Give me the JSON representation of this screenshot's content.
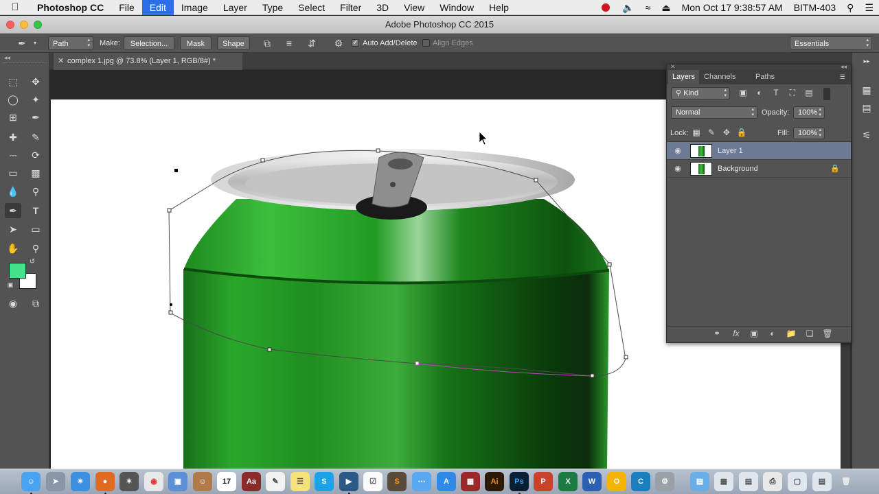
{
  "menubar": {
    "app_name": "Photoshop CC",
    "items": [
      "File",
      "Edit",
      "Image",
      "Layer",
      "Type",
      "Select",
      "Filter",
      "3D",
      "View",
      "Window",
      "Help"
    ],
    "active_item": "Edit",
    "datetime": "Mon Oct 17  9:38:57 AM",
    "user": "BITM-403"
  },
  "window": {
    "title": "Adobe Photoshop CC 2015"
  },
  "options_bar": {
    "tool_mode": "Path",
    "make_label": "Make:",
    "selection_button": "Selection...",
    "mask_button": "Mask",
    "shape_button": "Shape",
    "auto_add_delete_label": "Auto Add/Delete",
    "auto_add_delete_checked": true,
    "align_edges_label": "Align Edges",
    "align_edges_checked": false,
    "workspace": "Essentials"
  },
  "document": {
    "tab_title": "complex 1.jpg @ 73.8% (Layer 1, RGB/8#) *"
  },
  "colors": {
    "foreground": "#44e38b",
    "background": "#ffffff",
    "can_green": "#1f8a1f",
    "selected_layer": "#6c7b93"
  },
  "layers_panel": {
    "tabs": [
      "Layers",
      "Channels",
      "Paths"
    ],
    "active_tab": "Layers",
    "filter_kind": "Kind",
    "blend_mode": "Normal",
    "opacity_label": "Opacity:",
    "opacity_value": "100%",
    "lock_label": "Lock:",
    "fill_label": "Fill:",
    "fill_value": "100%",
    "layers": [
      {
        "name": "Layer 1",
        "selected": true,
        "locked": false
      },
      {
        "name": "Background",
        "selected": false,
        "locked": true
      }
    ]
  },
  "dock": {
    "apps": [
      "finder-icon",
      "launchpad-icon",
      "safari-icon",
      "firefox-icon",
      "compass-icon",
      "chrome-icon",
      "preview-icon",
      "contacts-icon",
      "calendar-icon",
      "dictionary-icon",
      "textedit-icon",
      "notes-icon",
      "skype-icon",
      "quicktime-icon",
      "reminders-icon",
      "sublime-icon",
      "messages-icon",
      "appstore-icon",
      "photobooth-icon",
      "illustrator-icon",
      "photoshop-icon",
      "powerpoint-icon",
      "excel-icon",
      "word-icon",
      "vlc-icon",
      "cyberduck-icon",
      "system-preferences-icon",
      "folder-icon",
      "downloads-icon",
      "documents-icon",
      "printer-icon",
      "screenshots-icon",
      "trash-icon"
    ],
    "illustrator_label": "Ai",
    "photoshop_label": "Ps",
    "calendar_day": "17"
  }
}
